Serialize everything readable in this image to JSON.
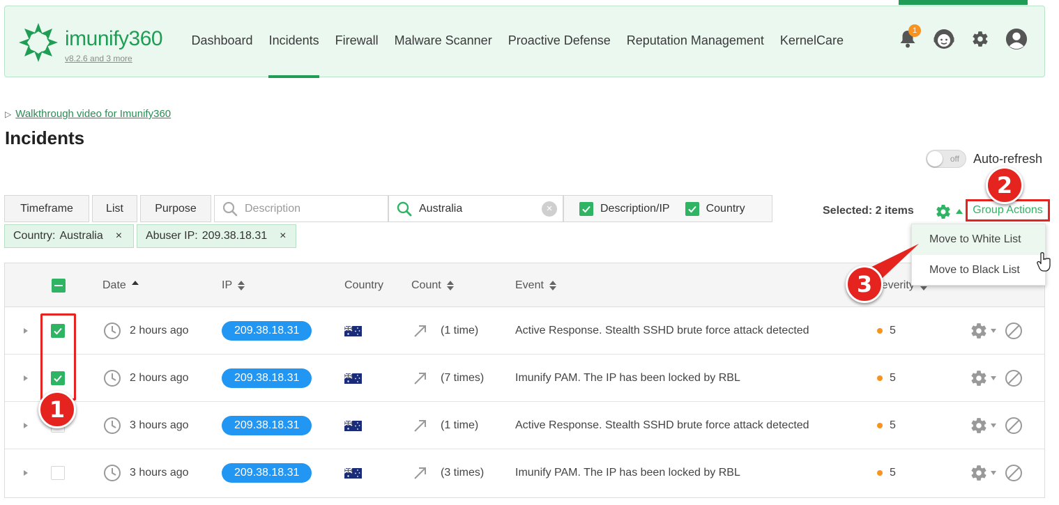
{
  "header": {
    "brand": "imunify360",
    "version": "v8.2.6 and 3 more",
    "nav": [
      {
        "label": "Dashboard",
        "active": false
      },
      {
        "label": "Incidents",
        "active": true
      },
      {
        "label": "Firewall",
        "active": false
      },
      {
        "label": "Malware Scanner",
        "active": false
      },
      {
        "label": "Proactive Defense",
        "active": false
      },
      {
        "label": "Reputation Management",
        "active": false
      },
      {
        "label": "KernelCare",
        "active": false
      }
    ],
    "notifications_count": "1",
    "icons": [
      "bell-icon",
      "support-agent-icon",
      "gear-icon",
      "user-avatar-icon"
    ]
  },
  "walkthrough_link": "Walkthrough video for Imunify360",
  "page_title": "Incidents",
  "auto_refresh": {
    "label": "Auto-refresh",
    "state": "off"
  },
  "filters": {
    "timeframe": "Timeframe",
    "list": "List",
    "purpose": "Purpose",
    "description_placeholder": "Description",
    "country_search_value": "Australia",
    "checks": [
      {
        "label": "Description/IP",
        "checked": true
      },
      {
        "label": "Country",
        "checked": true
      }
    ],
    "chips": [
      {
        "key": "Country:",
        "value": "Australia"
      },
      {
        "key": "Abuser IP:",
        "value": "209.38.18.31"
      }
    ]
  },
  "selection": {
    "selected_text": "Selected: 2 items",
    "group_actions_label": "Group Actions",
    "menu": [
      "Move to White List",
      "Move to Black List"
    ]
  },
  "table": {
    "columns": {
      "date": "Date",
      "ip": "IP",
      "country": "Country",
      "count": "Count",
      "event": "Event",
      "severity": "Severity"
    },
    "rows": [
      {
        "checked": true,
        "date": "2 hours ago",
        "ip": "209.38.18.31",
        "country_flag": "australia-flag-icon",
        "count": "(1 time)",
        "event": "Active Response. Stealth SSHD brute force attack detected",
        "severity": "5"
      },
      {
        "checked": true,
        "date": "2 hours ago",
        "ip": "209.38.18.31",
        "country_flag": "australia-flag-icon",
        "count": "(7 times)",
        "event": "Imunify PAM. The IP has been locked by RBL",
        "severity": "5"
      },
      {
        "checked": false,
        "date": "3 hours ago",
        "ip": "209.38.18.31",
        "country_flag": "australia-flag-icon",
        "count": "(1 time)",
        "event": "Active Response. Stealth SSHD brute force attack detected",
        "severity": "5"
      },
      {
        "checked": false,
        "date": "3 hours ago",
        "ip": "209.38.18.31",
        "country_flag": "australia-flag-icon",
        "count": "(3 times)",
        "event": "Imunify PAM. The IP has been locked by RBL",
        "severity": "5"
      }
    ]
  },
  "annotations": {
    "step1": "1",
    "step2": "2",
    "step3": "3",
    "color": "#e52420"
  },
  "colors": {
    "brand_green": "#1f9d55",
    "check_green": "#2fb463",
    "ip_blue": "#2196f3",
    "severity_orange": "#f7931e"
  }
}
